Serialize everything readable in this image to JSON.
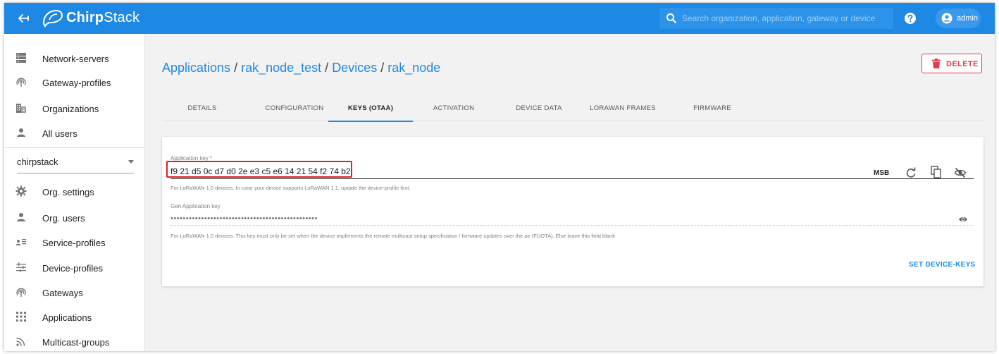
{
  "header": {
    "brand_bold": "Chirp",
    "brand_light": "Stack",
    "search_placeholder": "Search organization, application, gateway or device",
    "user": "admin"
  },
  "sidebar": {
    "items_top": [
      {
        "label": "Network-servers",
        "icon": "server-icon"
      },
      {
        "label": "Gateway-profiles",
        "icon": "gateway-profile-icon"
      },
      {
        "label": "Organizations",
        "icon": "organization-icon"
      },
      {
        "label": "All users",
        "icon": "user-icon"
      }
    ],
    "organization": "chirpstack",
    "items_org": [
      {
        "label": "Org. settings",
        "icon": "settings-icon"
      },
      {
        "label": "Org. users",
        "icon": "user-icon"
      },
      {
        "label": "Service-profiles",
        "icon": "service-profile-icon"
      },
      {
        "label": "Device-profiles",
        "icon": "device-profile-icon"
      },
      {
        "label": "Gateways",
        "icon": "gateway-icon"
      },
      {
        "label": "Applications",
        "icon": "apps-icon"
      },
      {
        "label": "Multicast-groups",
        "icon": "rss-icon"
      }
    ]
  },
  "breadcrumb": {
    "items": [
      "Applications",
      "rak_node_test",
      "Devices",
      "rak_node"
    ],
    "separator": "/"
  },
  "actions": {
    "delete": "DELETE"
  },
  "tabs": [
    "DETAILS",
    "CONFIGURATION",
    "KEYS (OTAA)",
    "ACTIVATION",
    "DEVICE DATA",
    "LORAWAN FRAMES",
    "FIRMWARE"
  ],
  "active_tab": "KEYS (OTAA)",
  "form": {
    "app_key_label": "Application key *",
    "app_key_value": "f9 21 d5 0c d7 d0 2e e3 c5 e6 14 21 54 f2 74 b2",
    "byte_order": "MSB",
    "app_key_help": "For LoRaWAN 1.0 devices. In case your device supports LoRaWAN 1.1, update the device-profile first.",
    "gen_key_label": "Gen Application key",
    "gen_key_value": "••••••••••••••••••••••••••••••••••••••••••••••••",
    "gen_key_help": "For LoRaWAN 1.0 devices. This key must only be set when the device implements the remote multicast setup specification / firmware updates over the air (FUOTA). Else leave this field blank.",
    "submit": "SET DEVICE-KEYS"
  },
  "colors": {
    "primary": "#1e88e5",
    "danger": "#e53950",
    "highlight": "#e0201c"
  }
}
